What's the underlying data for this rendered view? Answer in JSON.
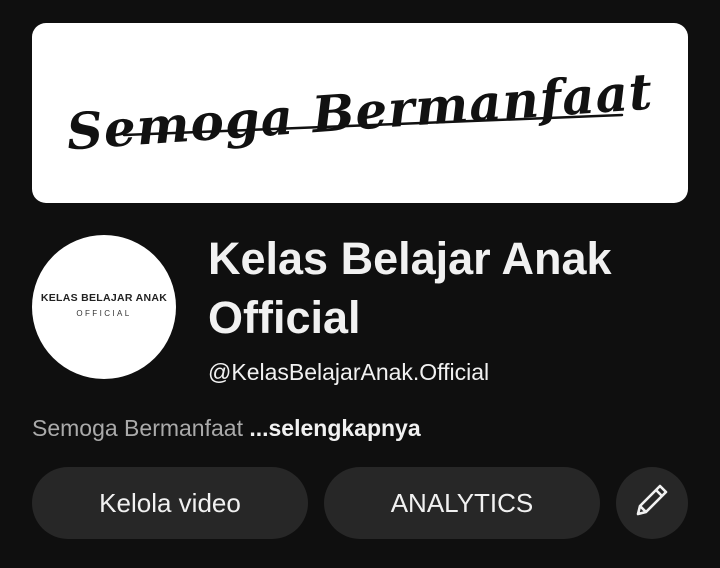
{
  "banner": {
    "text": "Semoga Bermanfaat"
  },
  "avatar": {
    "name": "KELAS BELAJAR ANAK",
    "sub": "OFFICIAL"
  },
  "channel": {
    "name": "Kelas Belajar Anak Official",
    "handle": "@KelasBelajarAnak.Official",
    "description": "Semoga Bermanfaat",
    "more_label": "...selengkapnya"
  },
  "actions": {
    "manage_label": "Kelola video",
    "analytics_label": "ANALYTICS",
    "edit_icon": "pencil-icon"
  },
  "colors": {
    "background": "#0f0f0f",
    "button_bg": "#272727",
    "text_primary": "#f1f1f1",
    "text_secondary": "#aaaaaa"
  }
}
